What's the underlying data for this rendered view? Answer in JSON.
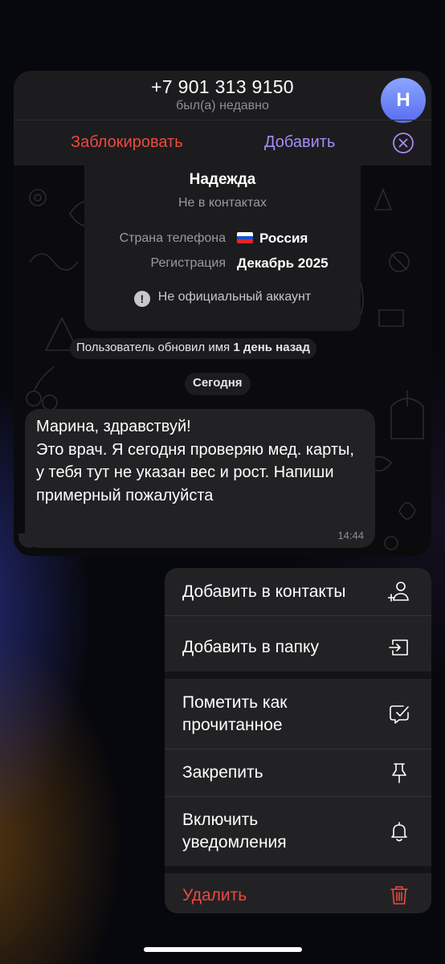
{
  "header": {
    "phone": "+7 901 313 9150",
    "status": "был(а) недавно",
    "avatar_letter": "Н",
    "block_label": "Заблокировать",
    "add_label": "Добавить"
  },
  "profile_card": {
    "name": "Надежда",
    "subtitle": "Не в контактах",
    "country_label": "Страна телефона",
    "country_value": "Россия",
    "registration_label": "Регистрация",
    "registration_value": "Декабрь 2025",
    "warning_text": "Не официальный аккаунт"
  },
  "service": {
    "name_update_prefix": "Пользователь обновил имя ",
    "name_update_bold": "1 день назад",
    "date_label": "Сегодня"
  },
  "message": {
    "text": "Марина, здравствуй!\nЭто врач. Я сегодня проверяю мед. карты, у тебя тут не указан вес и рост. Напиши примерный пожалуйста",
    "time": "14:44"
  },
  "menu": {
    "items": [
      {
        "label": "Добавить в контакты",
        "icon": "add-contact-icon"
      },
      {
        "label": "Добавить в папку",
        "icon": "folder-add-icon"
      },
      {
        "label": "Пометить как\nпрочитанное",
        "icon": "mark-read-icon"
      },
      {
        "label": "Закрепить",
        "icon": "pin-icon"
      },
      {
        "label": "Включить\nуведомления",
        "icon": "bell-icon"
      },
      {
        "label": "Удалить",
        "icon": "trash-icon"
      }
    ]
  },
  "colors": {
    "danger": "#eb4a3f",
    "accent": "#a78bf7",
    "avatar_top": "#8aa6ff",
    "avatar_bottom": "#5a6cf0",
    "surface": "#1c1c1e",
    "menu_bg": "#222224"
  }
}
